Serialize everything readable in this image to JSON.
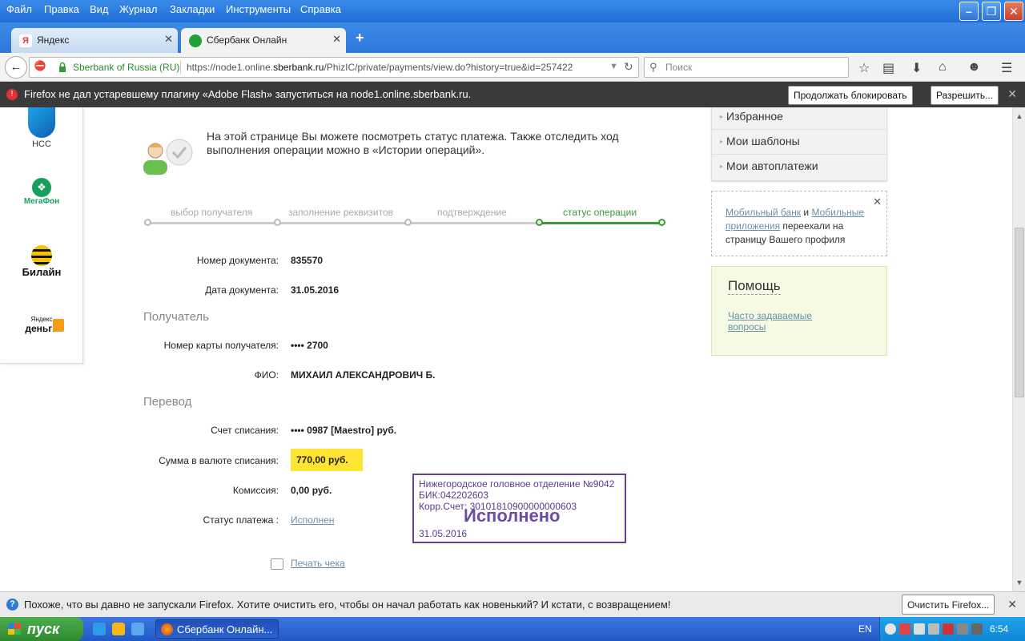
{
  "menubar": {
    "items": [
      "Файл",
      "Правка",
      "Вид",
      "Журнал",
      "Закладки",
      "Инструменты",
      "Справка"
    ]
  },
  "tabs": [
    {
      "label": "Яндекс",
      "favicon": "Я"
    },
    {
      "label": "Сбербанк Онлайн"
    }
  ],
  "urlbar": {
    "identity": "Sberbank of Russia (RU)",
    "url_prefix": "https://node1.online.",
    "url_domain": "sberbank.ru",
    "url_suffix": "/PhizIC/private/payments/view.do?history=true&id=257422"
  },
  "search": {
    "placeholder": "Поиск"
  },
  "flashbar": {
    "message": "Firefox не дал устаревшему плагину «Adobe Flash» запуститься на node1.online.sberbank.ru.",
    "keep_blocking": "Продолжать блокировать",
    "allow": "Разрешить..."
  },
  "left_brands": {
    "nss": "НСС",
    "megafon": "МегаФон",
    "beeline": "Билайн",
    "ymoney_top": "Яндекс",
    "ymoney_bottom": "деньги"
  },
  "intro": {
    "text": "На этой странице Вы можете посмотреть статус платежа. Также отследить ход выполнения операции можно в «Истории операций»."
  },
  "steps": [
    {
      "label": "выбор получателя",
      "active": false
    },
    {
      "label": "заполнение реквизитов",
      "active": false
    },
    {
      "label": "подтверждение",
      "active": false
    },
    {
      "label": "статус операции",
      "active": true
    }
  ],
  "document": {
    "number_label": "Номер документа:",
    "number_value": "835570",
    "date_label": "Дата документа:",
    "date_value": "31.05.2016"
  },
  "recipient": {
    "section_title": "Получатель",
    "card_label": "Номер карты получателя:",
    "card_value": "•••• 2700",
    "name_label": "ФИО:",
    "name_value": "МИХАИЛ АЛЕКСАНДРОВИЧ Б."
  },
  "transfer": {
    "section_title": "Перевод",
    "account_label": "Счет списания:",
    "account_value": "•••• 0987  [Maestro]  руб.",
    "amount_label": "Сумма в валюте списания:",
    "amount_value": "770,00  руб.",
    "fee_label": "Комиссия:",
    "fee_value": "0,00 руб.",
    "status_label": "Статус платежа :",
    "status_value": "Исполнен"
  },
  "stamp": {
    "line1": "Нижегородское головное отделение №9042",
    "line2": "БИК:042202603",
    "line3": "Корр.Счет: 30101810900000000603",
    "big": "Исполнено",
    "date": "31.05.2016"
  },
  "print": {
    "label": "Печать чека"
  },
  "right_menu": {
    "items": [
      "Избранное",
      "Мои шаблоны",
      "Мои автоплатежи"
    ]
  },
  "tip": {
    "link1": "Мобильный банк",
    "and": " и ",
    "link2": "Мобильные приложения",
    "rest": " переехали на страницу Вашего профиля"
  },
  "help": {
    "title": "Помощь",
    "faq": "Часто задаваемые вопросы"
  },
  "notifybar": {
    "message": "Похоже, что вы давно не запускали Firefox. Хотите очистить его, чтобы он начал работать как новенький? И кстати, с возвращением!",
    "button": "Очистить Firefox..."
  },
  "taskbar": {
    "start": "пуск",
    "task": "Сбербанк Онлайн...",
    "lang": "EN",
    "clock": "6:54"
  },
  "colors": {
    "sber_green": "#3a9a3a",
    "amount_highlight": "#fde532",
    "stamp_purple": "#6b3f98",
    "link": "#6a8fa8"
  }
}
